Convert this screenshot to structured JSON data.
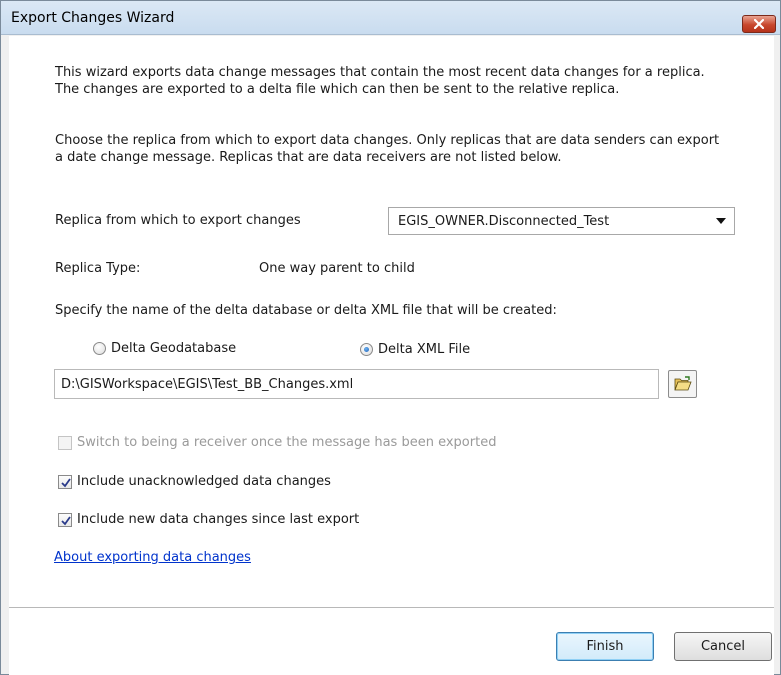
{
  "window": {
    "title": "Export Changes Wizard"
  },
  "intro": {
    "line1": "This wizard exports data change messages that contain the most recent data changes for a replica.",
    "line2": "The changes are exported to a delta file which can then be sent to the relative replica."
  },
  "choose": {
    "line1": "Choose the replica from which to export data changes. Only replicas that are data senders can export",
    "line2": "a date change message. Replicas that are data receivers are not listed below."
  },
  "replica": {
    "label": "Replica from which to export changes",
    "selected": "EGIS_OWNER.Disconnected_Test",
    "type_label": "Replica Type:",
    "type_value": "One way parent to child"
  },
  "delta": {
    "instruction": "Specify the name of the delta database or delta XML file that will be created:",
    "option_geodatabase": "Delta Geodatabase",
    "option_xml": "Delta XML File",
    "selected_option": "Delta XML File",
    "path_value": "D:\\GISWorkspace\\EGIS\\Test_BB_Changes.xml"
  },
  "options": {
    "switch_receiver": {
      "label": "Switch to being a receiver once the message has been exported",
      "checked": false,
      "enabled": false
    },
    "include_unacknowledged": {
      "label": "Include unacknowledged data changes",
      "checked": true,
      "enabled": true
    },
    "include_new": {
      "label": "Include new data changes since last export",
      "checked": true,
      "enabled": true
    }
  },
  "help_link": "About exporting data changes",
  "buttons": {
    "finish": "Finish",
    "cancel": "Cancel"
  },
  "icons": {
    "close": "close-icon",
    "dropdown": "chevron-down-icon",
    "browse": "open-folder-icon",
    "check": "checkmark-icon"
  },
  "colors": {
    "title_bar": "#c9dcef",
    "close_button": "#c8472d",
    "link": "#0033cc",
    "radio_selected": "#1a5fb8"
  }
}
